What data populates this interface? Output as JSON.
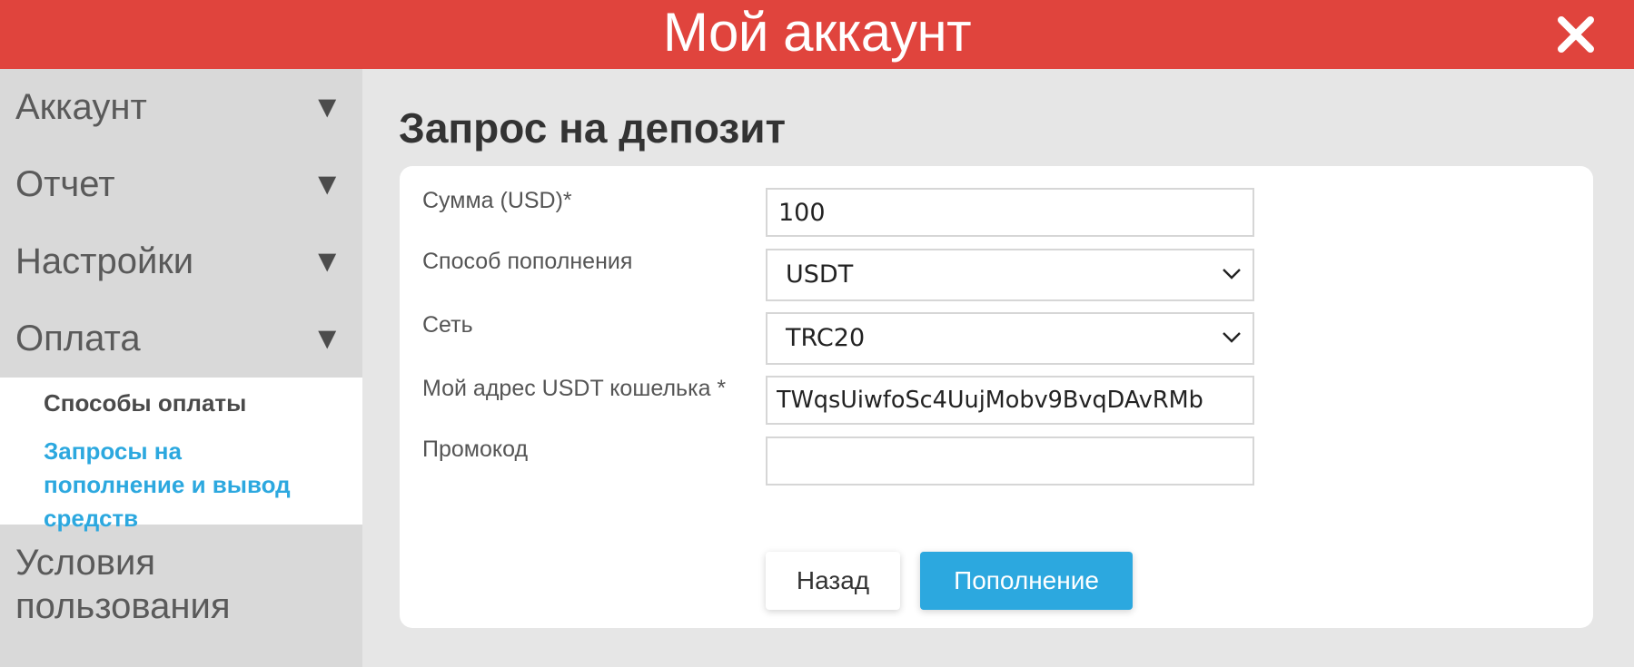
{
  "header": {
    "title": "Мой аккаунт",
    "close_icon": "close-icon"
  },
  "sidebar": {
    "items": [
      {
        "label": "Аккаунт",
        "caret": "▼"
      },
      {
        "label": "Отчет",
        "caret": "▼"
      },
      {
        "label": "Настройки",
        "caret": "▼"
      },
      {
        "label": "Оплата",
        "caret": "▼"
      }
    ],
    "submenu": [
      {
        "label": "Способы оплаты"
      },
      {
        "label": "Запросы на пополнение и вывод средств"
      }
    ],
    "terms": {
      "label": "Условия пользования"
    }
  },
  "main": {
    "title": "Запрос на депозит",
    "form": {
      "amount": {
        "label": "Сумма (USD)*",
        "value": "100"
      },
      "method": {
        "label": "Способ пополнения",
        "value": "USDT"
      },
      "network": {
        "label": "Сеть",
        "value": "TRC20"
      },
      "wallet": {
        "label": "Мой адрес USDT кошелька *",
        "value": "TWqsUiwfoSc4UujMobv9BvqDAvRMb"
      },
      "promo": {
        "label": "Промокод",
        "value": ""
      }
    },
    "buttons": {
      "back": "Назад",
      "submit": "Пополнение"
    }
  },
  "colors": {
    "header": "#e0443d",
    "accent": "#2ca8df",
    "sidebar": "#d9d9d9",
    "background": "#e6e6e6"
  }
}
